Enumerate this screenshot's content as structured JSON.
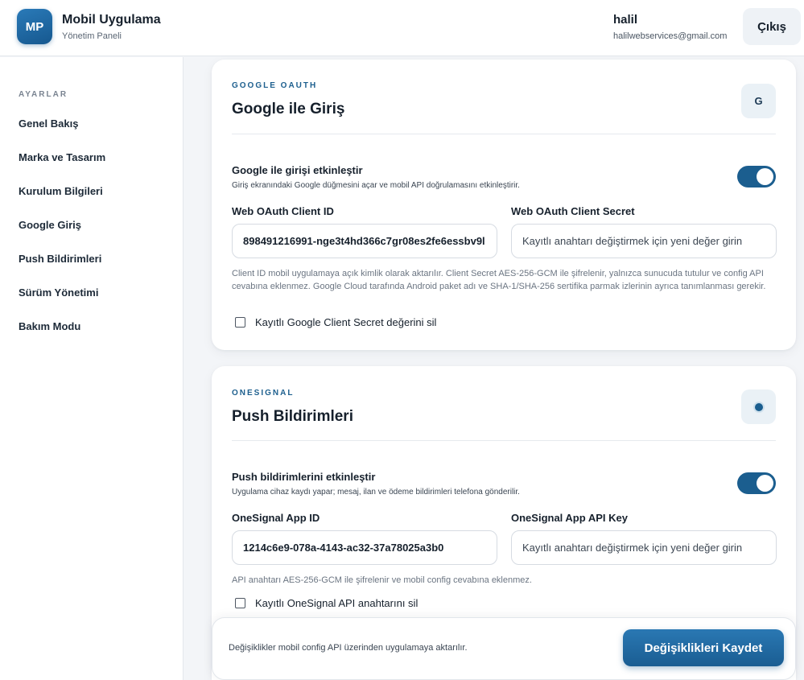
{
  "header": {
    "logo_text": "MP",
    "app_title": "Mobil Uygulama",
    "app_subtitle": "Yönetim Paneli",
    "user_name": "halil",
    "user_email": "halilwebservices@gmail.com",
    "logout_label": "Çıkış"
  },
  "sidebar": {
    "heading": "AYARLAR",
    "items": [
      {
        "label": "Genel Bakış"
      },
      {
        "label": "Marka ve Tasarım"
      },
      {
        "label": "Kurulum Bilgileri"
      },
      {
        "label": "Google Giriş"
      },
      {
        "label": "Push Bildirimleri"
      },
      {
        "label": "Sürüm Yönetimi"
      },
      {
        "label": "Bakım Modu"
      }
    ]
  },
  "google": {
    "eyebrow": "GOOGLE OAUTH",
    "title": "Google ile Giriş",
    "icon_text": "G",
    "toggle_title": "Google ile girişi etkinleştir",
    "toggle_desc": "Giriş ekranındaki Google düğmesini açar ve mobil API doğrulamasını etkinleştirir.",
    "toggle_on": true,
    "client_id_label": "Web OAuth Client ID",
    "client_id_value": "898491216991-nge3t4hd366c7gr08es2fe6essbv9l",
    "client_secret_label": "Web OAuth Client Secret",
    "client_secret_placeholder": "Kayıtlı anahtarı değiştirmek için yeni değer girin",
    "help_text": "Client ID mobil uygulamaya açık kimlik olarak aktarılır. Client Secret AES-256-GCM ile şifrelenir, yalnızca sunucuda tutulur ve config API cevabına eklenmez. Google Cloud tarafında Android paket adı ve SHA-1/SHA-256 sertifika parmak izlerinin ayrıca tanımlanması gerekir.",
    "checkbox_label": "Kayıtlı Google Client Secret değerini sil"
  },
  "onesignal": {
    "eyebrow": "ONESIGNAL",
    "title": "Push Bildirimleri",
    "toggle_title": "Push bildirimlerini etkinleştir",
    "toggle_desc": "Uygulama cihaz kaydı yapar; mesaj, ilan ve ödeme bildirimleri telefona gönderilir.",
    "toggle_on": true,
    "app_id_label": "OneSignal App ID",
    "app_id_value": "1214c6e9-078a-4143-ac32-37a78025a3b0",
    "api_key_label": "OneSignal App API Key",
    "api_key_placeholder": "Kayıtlı anahtarı değiştirmek için yeni değer girin",
    "help_text": "API anahtarı AES-256-GCM ile şifrelenir ve mobil config cevabına eklenmez.",
    "checkbox_label": "Kayıtlı OneSignal API anahtarını sil"
  },
  "savebar": {
    "note": "Değişiklikler mobil config API üzerinden uygulamaya aktarılır.",
    "save_label": "Değişiklikleri Kaydet"
  }
}
